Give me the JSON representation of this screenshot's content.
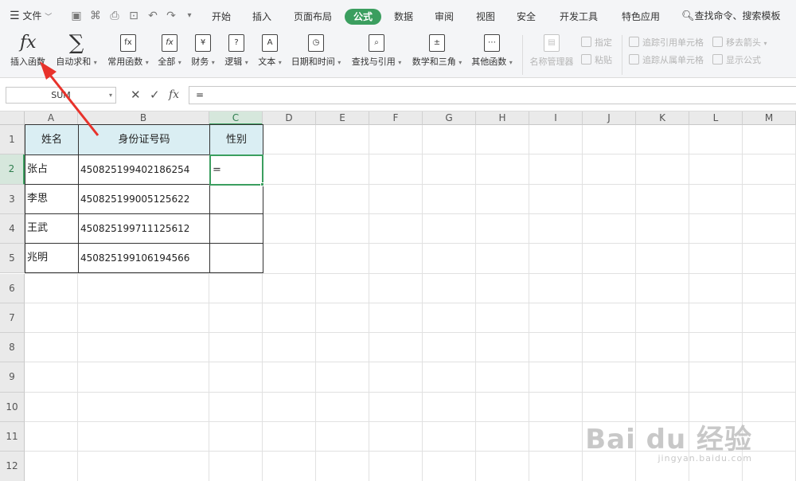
{
  "menubar": {
    "file_label": "文件",
    "tabs": [
      {
        "label": "开始",
        "active": false
      },
      {
        "label": "插入",
        "active": false
      },
      {
        "label": "页面布局",
        "active": false
      },
      {
        "label": "公式",
        "active": true
      },
      {
        "label": "数据",
        "active": false
      },
      {
        "label": "审阅",
        "active": false
      },
      {
        "label": "视图",
        "active": false
      },
      {
        "label": "安全",
        "active": false
      },
      {
        "label": "开发工具",
        "active": false
      },
      {
        "label": "特色应用",
        "active": false
      }
    ],
    "search_label": "查找命令、搜索模板",
    "accent_color": "#3b9e5f"
  },
  "ribbon": {
    "insert_function": {
      "icon": "fx",
      "label": "插入函数"
    },
    "autosum": {
      "icon": "∑",
      "label": "自动求和"
    },
    "common_functions": {
      "label": "常用函数"
    },
    "all": {
      "label": "全部"
    },
    "finance": {
      "label": "财务"
    },
    "logic": {
      "label": "逻辑"
    },
    "text": {
      "label": "文本"
    },
    "datetime": {
      "label": "日期和时间"
    },
    "lookup": {
      "label": "查找与引用"
    },
    "math": {
      "label": "数学和三角"
    },
    "other": {
      "label": "其他函数"
    },
    "name_manager": {
      "label": "名称管理器"
    },
    "define": {
      "label": "指定"
    },
    "paste": {
      "label": "粘贴"
    },
    "trace_precedents": {
      "label": "追踪引用单元格"
    },
    "trace_dependents": {
      "label": "追踪从属单元格"
    },
    "remove_arrows": {
      "label": "移去箭头"
    },
    "show_formulas": {
      "label": "显示公式"
    }
  },
  "formulabar": {
    "name_box": "SUM",
    "fx": "fx",
    "formula": "="
  },
  "sheet": {
    "columns": [
      "A",
      "B",
      "C",
      "D",
      "E",
      "F",
      "G",
      "H",
      "I",
      "J",
      "K",
      "L",
      "M"
    ],
    "rows": [
      "1",
      "2",
      "3",
      "4",
      "5",
      "6",
      "7",
      "8",
      "9",
      "10",
      "11",
      "12"
    ],
    "active_column": "C",
    "active_row": "2",
    "header": {
      "name": "姓名",
      "id": "身份证号码",
      "gender": "性别"
    },
    "records": [
      {
        "name": "张占",
        "id": "450825199402186254",
        "gender": "="
      },
      {
        "name": "李思",
        "id": "450825199005125622",
        "gender": ""
      },
      {
        "name": "王武",
        "id": "450825199711125612",
        "gender": ""
      },
      {
        "name": "兆明",
        "id": "450825199106194566",
        "gender": ""
      }
    ]
  },
  "watermark": {
    "logo": "Bai du 经验",
    "url": "jingyan.baidu.com"
  }
}
